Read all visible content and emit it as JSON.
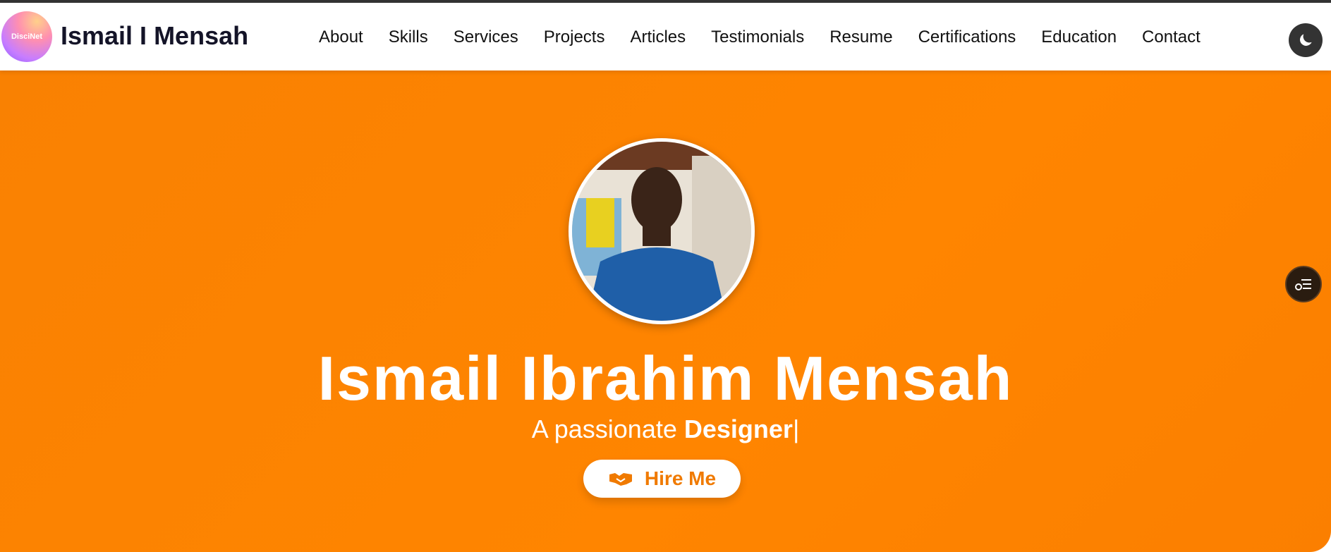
{
  "header": {
    "logo_text": "DisciNet",
    "brand": "Ismail I Mensah",
    "nav": [
      {
        "label": "About"
      },
      {
        "label": "Skills"
      },
      {
        "label": "Services"
      },
      {
        "label": "Projects"
      },
      {
        "label": "Articles"
      },
      {
        "label": "Testimonials"
      },
      {
        "label": "Resume"
      },
      {
        "label": "Certifications"
      },
      {
        "label": "Education"
      },
      {
        "label": "Contact"
      }
    ],
    "theme_toggle_icon": "moon-icon"
  },
  "hero": {
    "name": "Ismail Ibrahim Mensah",
    "tagline_prefix": "A passionate ",
    "tagline_role": "Designer",
    "cursor": "|",
    "hire_label": "Hire Me",
    "hire_icon": "handshake-icon",
    "avatar_alt": "profile-photo"
  },
  "side_widget": {
    "icon": "menu-list-icon"
  },
  "colors": {
    "hero_bg": "#fb8200",
    "accent": "#f07a00",
    "dark": "#333333"
  }
}
